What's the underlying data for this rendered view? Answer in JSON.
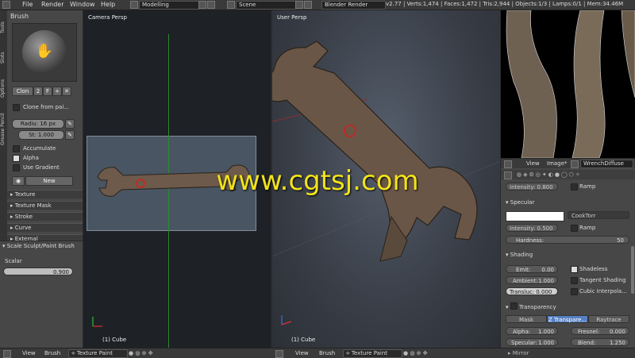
{
  "topbar": {
    "menus": [
      "File",
      "Render",
      "Window",
      "Help"
    ],
    "layout": "Modelling",
    "scene": "Scene",
    "engine": "Blender Render",
    "stats": "v2.77 | Verts:1,474 | Faces:1,472 | Tris:2,944 | Objects:1/3 | Lamps:0/1 | Mem:34.46M"
  },
  "tabs": [
    "Tools",
    "Slots",
    "Options",
    "Grease Pencil"
  ],
  "shelf": {
    "brush_panel": "Brush",
    "brush_name": "Clon",
    "brush_users": "2",
    "brush_f": "F",
    "clone_label": "Clone from pai...",
    "radius": "Radiu: 16 px",
    "strength": "St: 1.000",
    "accumulate": "Accumulate",
    "alpha": "Alpha",
    "use_gradient": "Use Gradient",
    "new_button": "New",
    "panels": [
      "Texture",
      "Texture Mask",
      "Stroke",
      "Curve",
      "External"
    ],
    "operator_title": "Scale Sculpt/Paint Brush",
    "scalar_label": "Scalar",
    "scalar_value": "0.900"
  },
  "camera_view": {
    "title": "Camera Persp",
    "object": "(1) Cube"
  },
  "user_view": {
    "title": "User Persp",
    "object": "(1) Cube"
  },
  "properties": {
    "header_view": "View",
    "header_image": "Image*",
    "material_name": "WrenchDiffuse",
    "intensity_top": "Intensity: 0.800",
    "ramp_top": "Ramp",
    "specular_title": "Specular",
    "spec_shader": "CookTorr",
    "spec_intensity": "Intensity: 0.500",
    "spec_ramp": "Ramp",
    "hardness_label": "Hardness:",
    "hardness_value": "50",
    "shading_title": "Shading",
    "emit_label": "Emit:",
    "emit_value": "0.00",
    "ambient_label": "Ambient:",
    "ambient_value": "1.000",
    "transluc": "Transluc: 0.000",
    "shadeless": "Shadeless",
    "tangent_shading": "Tangent Shading",
    "cubic": "Cubic Interpola...",
    "transparency_title": "Transparency",
    "transp_tabs": [
      "Mask",
      "Z Transpare...",
      "Raytrace"
    ],
    "alpha_label": "Alpha:",
    "alpha_value": "1.000",
    "fresnel_label": "Fresnel:",
    "fresnel_value": "0.000",
    "specular_label": "Specular:",
    "specular_value": "1.000",
    "blend_label": "Blend:",
    "blend_value": "1.250",
    "mirror_title": "Mirror"
  },
  "bottombar": {
    "view": "View",
    "brush": "Brush",
    "mode_left": "Texture Paint",
    "view2": "View",
    "brush2": "Brush",
    "mode_right": "Texture Paint"
  },
  "watermark": "www.cgtsj.com"
}
